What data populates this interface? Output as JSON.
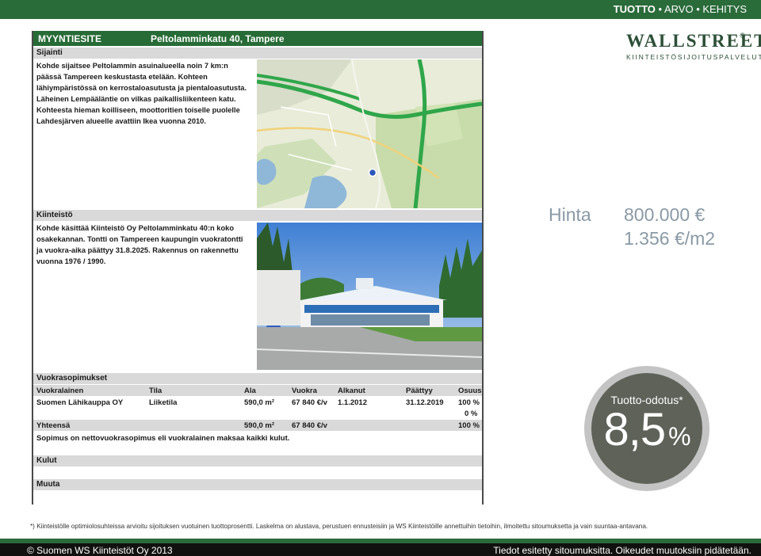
{
  "topbar": {
    "tag_bold": "TUOTTO",
    "tag_rest": " • ARVO • KEHITYS"
  },
  "logo": {
    "main": "WALLSTREET",
    "sub": "KIINTEISTÖSIJOITUSPALVELUT",
    "reg": "©"
  },
  "price": {
    "label": "Hinta",
    "value": "800.000 €",
    "per_m2": "1.356 €/m2"
  },
  "yield": {
    "label": "Tuotto-odotus*",
    "value": "8,5",
    "unit": "%"
  },
  "doc": {
    "header_left": "MYYNTIESITE",
    "header_right": "Peltolamminkatu 40, Tampere",
    "sijainti": {
      "title": "Sijainti",
      "lines": [
        "Kohde sijaitsee Peltolammin asuinalueella noin 7 km:n",
        "päässä Tampereen keskustasta etelään. Kohteen",
        "lähiympäristössä on kerrostaloasutusta ja pientaloasutusta.",
        "Läheinen Lempääläntie on vilkas paikallisliikenteen katu.",
        "Kohteesta hieman koilliseen, moottoritien toiselle puolelle",
        "Lahdesjärven alueelle avattiin Ikea vuonna 2010."
      ]
    },
    "kiinteisto": {
      "title": "Kiinteistö",
      "lines": [
        "Kohde käsittää Kiinteistö Oy Peltolamminkatu 40:n koko",
        "osakekannan. Tontti on Tampereen kaupungin vuokratontti",
        "ja vuokra-aika päättyy 31.8.2025. Rakennus on rakennettu",
        "vuonna 1976 / 1990."
      ]
    },
    "vuokra": {
      "title": "Vuokrasopimukset",
      "headers": [
        "Vuokralainen",
        "Tila",
        "Ala",
        "Vuokra",
        "Alkanut",
        "Päättyy",
        "Osuus"
      ],
      "row": [
        "Suomen Lähikauppa OY",
        "Liiketila",
        "590,0 m²",
        "67 840 €/v",
        "1.1.2012",
        "31.12.2019",
        "100 %"
      ],
      "empty_share": "0 %",
      "total": [
        "Yhteensä",
        "590,0 m²",
        "67 840 €/v",
        "100 %"
      ],
      "note": "Sopimus on nettovuokrasopimus eli vuokralainen maksaa kaikki kulut."
    },
    "kulut": {
      "title": "Kulut"
    },
    "muuta": {
      "title": "Muuta"
    }
  },
  "footnote": "*) Kiinteistölle optimiolosuhteissa arvioitu sijoituksen vuotuinen tuottoprosentti. Laskelma on alustava, perustuen ennusteisiin ja WS Kiinteistöille annettuihin tietoihin, ilmoitettu sitoumuksetta ja vain suuntaa-antavana.",
  "bottom": {
    "left": "© Suomen WS Kiinteistöt Oy 2013",
    "right": "Tiedot esitetty sitoumuksitta. Oikeudet muutoksiin pidätetään."
  },
  "colors": {
    "brand_green": "#2a6b3a",
    "circle_fill": "#5e6259",
    "price_text": "#8a9aa6"
  }
}
